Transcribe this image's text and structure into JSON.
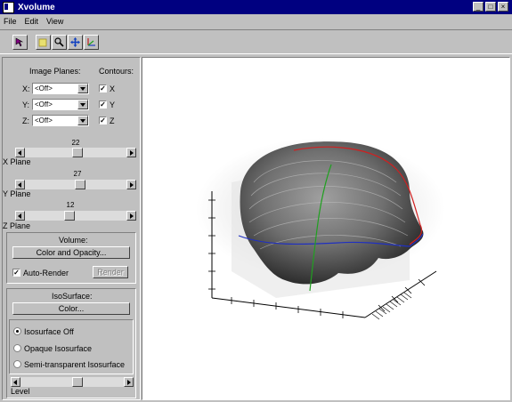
{
  "window": {
    "title": "Xvolume",
    "min_glyph": "_",
    "max_glyph": "□",
    "close_glyph": "×"
  },
  "menu": [
    "File",
    "Edit",
    "View"
  ],
  "toolbar_icons": [
    "select-icon",
    "pan-icon",
    "zoom-icon",
    "move-icon",
    "rotate-icon"
  ],
  "panel": {
    "image_planes_label": "Image Planes:",
    "contours_label": "Contours:",
    "planes": [
      {
        "axis": "X:",
        "value": "<Off>",
        "contour_label": "X",
        "contour_checked": true
      },
      {
        "axis": "Y:",
        "value": "<Off>",
        "contour_label": "Y",
        "contour_checked": true
      },
      {
        "axis": "Z:",
        "value": "<Off>",
        "contour_label": "Z",
        "contour_checked": true
      }
    ],
    "sliders": [
      {
        "value": "22",
        "label": "X Plane",
        "fraction": 0.52
      },
      {
        "value": "27",
        "label": "Y Plane",
        "fraction": 0.55
      },
      {
        "value": "12",
        "label": "Z Plane",
        "fraction": 0.43
      }
    ],
    "volume": {
      "label": "Volume:",
      "color_opacity_button": "Color and Opacity...",
      "auto_render_label": "Auto-Render",
      "auto_render_checked": true,
      "render_button": "Render"
    },
    "isosurface": {
      "label": "IsoSurface:",
      "color_button": "Color...",
      "options": [
        "Isosurface Off",
        "Opaque Isosurface",
        "Semi-transparent Isosurface"
      ],
      "selected": 0,
      "level_label": "Level",
      "level_fraction": 0.56
    }
  },
  "colors": {
    "titlebar": "#000080",
    "face": "#c0c0c0",
    "contour_red": "#d02020",
    "contour_blue": "#2030c0",
    "contour_green": "#20a020"
  }
}
